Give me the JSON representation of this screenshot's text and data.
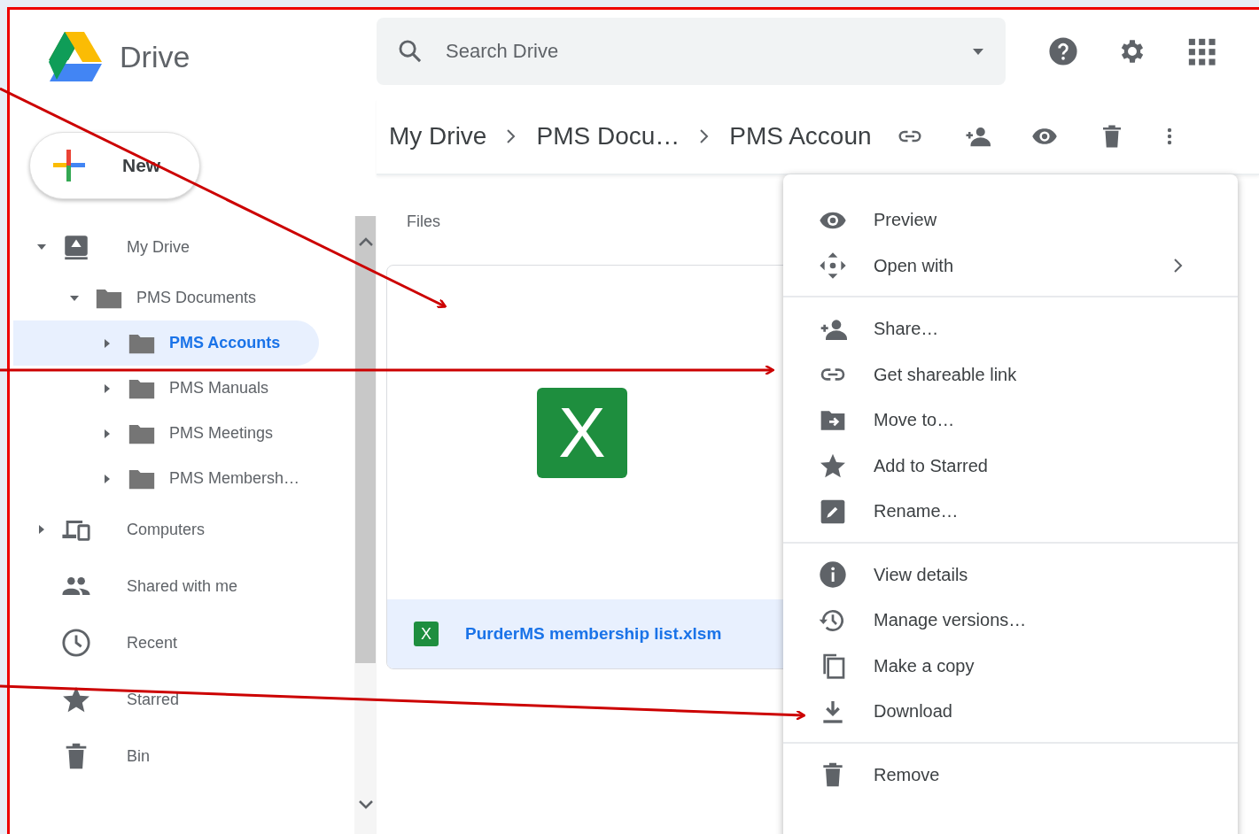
{
  "app": {
    "name": "Drive"
  },
  "new_button": {
    "label": "New"
  },
  "search": {
    "placeholder": "Search Drive"
  },
  "header_icons": [
    {
      "kind": "help"
    },
    {
      "kind": "settings"
    },
    {
      "kind": "apps"
    }
  ],
  "sidebar": {
    "items": [
      {
        "label": "My Drive",
        "kind": "drive",
        "expanded": true,
        "selected": false,
        "children": [
          {
            "label": "PMS Documents",
            "kind": "folder",
            "expanded": true,
            "selected": false,
            "children": [
              {
                "label": "PMS Accounts",
                "kind": "folder",
                "expanded": false,
                "selected": true
              },
              {
                "label": "PMS Manuals",
                "kind": "folder",
                "expanded": false,
                "selected": false
              },
              {
                "label": "PMS Meetings",
                "kind": "folder",
                "expanded": false,
                "selected": false
              },
              {
                "label": "PMS Membersh…",
                "kind": "folder",
                "expanded": false,
                "selected": false
              }
            ]
          }
        ]
      },
      {
        "label": "Computers",
        "kind": "computers",
        "expanded": false,
        "selected": false
      },
      {
        "label": "Shared with me",
        "kind": "shared",
        "selected": false
      },
      {
        "label": "Recent",
        "kind": "recent",
        "selected": false
      },
      {
        "label": "Starred",
        "kind": "star",
        "selected": false
      },
      {
        "label": "Bin",
        "kind": "bin",
        "selected": false
      }
    ]
  },
  "breadcrumb": [
    "My Drive",
    "PMS Docu…",
    "PMS Accoun"
  ],
  "toolbar": [
    {
      "kind": "link"
    },
    {
      "kind": "add-person"
    },
    {
      "kind": "eye"
    },
    {
      "kind": "bin"
    },
    {
      "kind": "more"
    }
  ],
  "files_section": {
    "label": "Files"
  },
  "files": [
    {
      "name": "PurderMS membership list.xlsm",
      "selected": true,
      "badge": "X",
      "preview_letter": "X"
    }
  ],
  "context_menu": {
    "groups": [
      [
        {
          "label": "Preview",
          "kind": "eye",
          "submenu": false
        },
        {
          "label": "Open with",
          "kind": "open-with",
          "submenu": true
        }
      ],
      [
        {
          "label": "Share…",
          "kind": "add-person",
          "submenu": false
        },
        {
          "label": "Get shareable link",
          "kind": "link",
          "submenu": false
        },
        {
          "label": "Move to…",
          "kind": "move",
          "submenu": false
        },
        {
          "label": "Add to Starred",
          "kind": "star",
          "submenu": false
        },
        {
          "label": "Rename…",
          "kind": "rename",
          "submenu": false
        }
      ],
      [
        {
          "label": "View details",
          "kind": "info",
          "submenu": false
        },
        {
          "label": "Manage versions…",
          "kind": "history",
          "submenu": false
        },
        {
          "label": "Make a copy",
          "kind": "copy",
          "submenu": false
        },
        {
          "label": "Download",
          "kind": "download",
          "submenu": false
        }
      ],
      [
        {
          "label": "Remove",
          "kind": "bin",
          "submenu": false
        }
      ]
    ]
  }
}
